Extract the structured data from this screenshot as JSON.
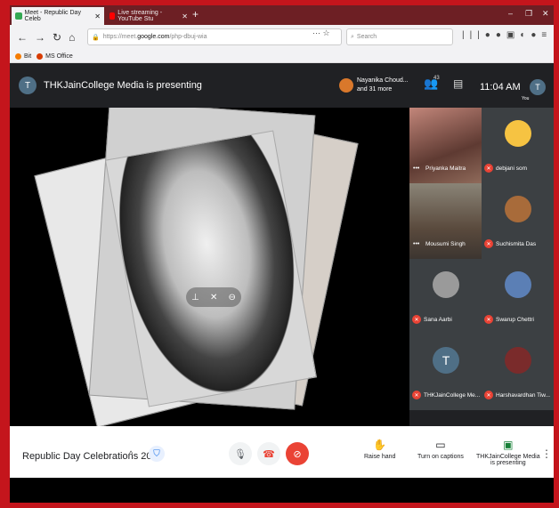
{
  "browser": {
    "tabs": [
      {
        "label": "Meet - Republic Day Celeb"
      },
      {
        "label": "Live streaming - YouTube Stu"
      }
    ],
    "url_prefix": "https://meet.",
    "url_host": "google.com",
    "url_path": "/php-dbuj-wia",
    "search_placeholder": "Search",
    "bookmarks": [
      {
        "label": "Bit"
      },
      {
        "label": "MS Office"
      }
    ]
  },
  "meet": {
    "presenter_initial": "T",
    "presenter_title": "THKJainCollege Media is presenting",
    "pinned_name": "Nayanika Choud...",
    "pinned_more": "and 31 more",
    "participant_count": "43",
    "time": "11:04 AM",
    "you_initial": "T",
    "you_label": "You",
    "participants": [
      {
        "name": "Priyanka Maitra"
      },
      {
        "name": "debjani som"
      },
      {
        "name": "Mousumi Singh"
      },
      {
        "name": "Suchismita Das"
      },
      {
        "name": "Sana Aarbi"
      },
      {
        "name": "Swarup Chettri"
      },
      {
        "name": "THKJainCollege Me..."
      },
      {
        "name": "Harshavardhan Tiw..."
      }
    ],
    "meeting_name": "Republic Day Celebrations 2021",
    "actions": {
      "raise_hand": "Raise hand",
      "captions": "Turn on captions",
      "presenting_line1": "THKJainCollege Media",
      "presenting_line2": "is presenting"
    }
  },
  "colors": {
    "accent_blue": "#1a73e8",
    "end_call_red": "#ea4335",
    "border_red": "#c4151c"
  }
}
